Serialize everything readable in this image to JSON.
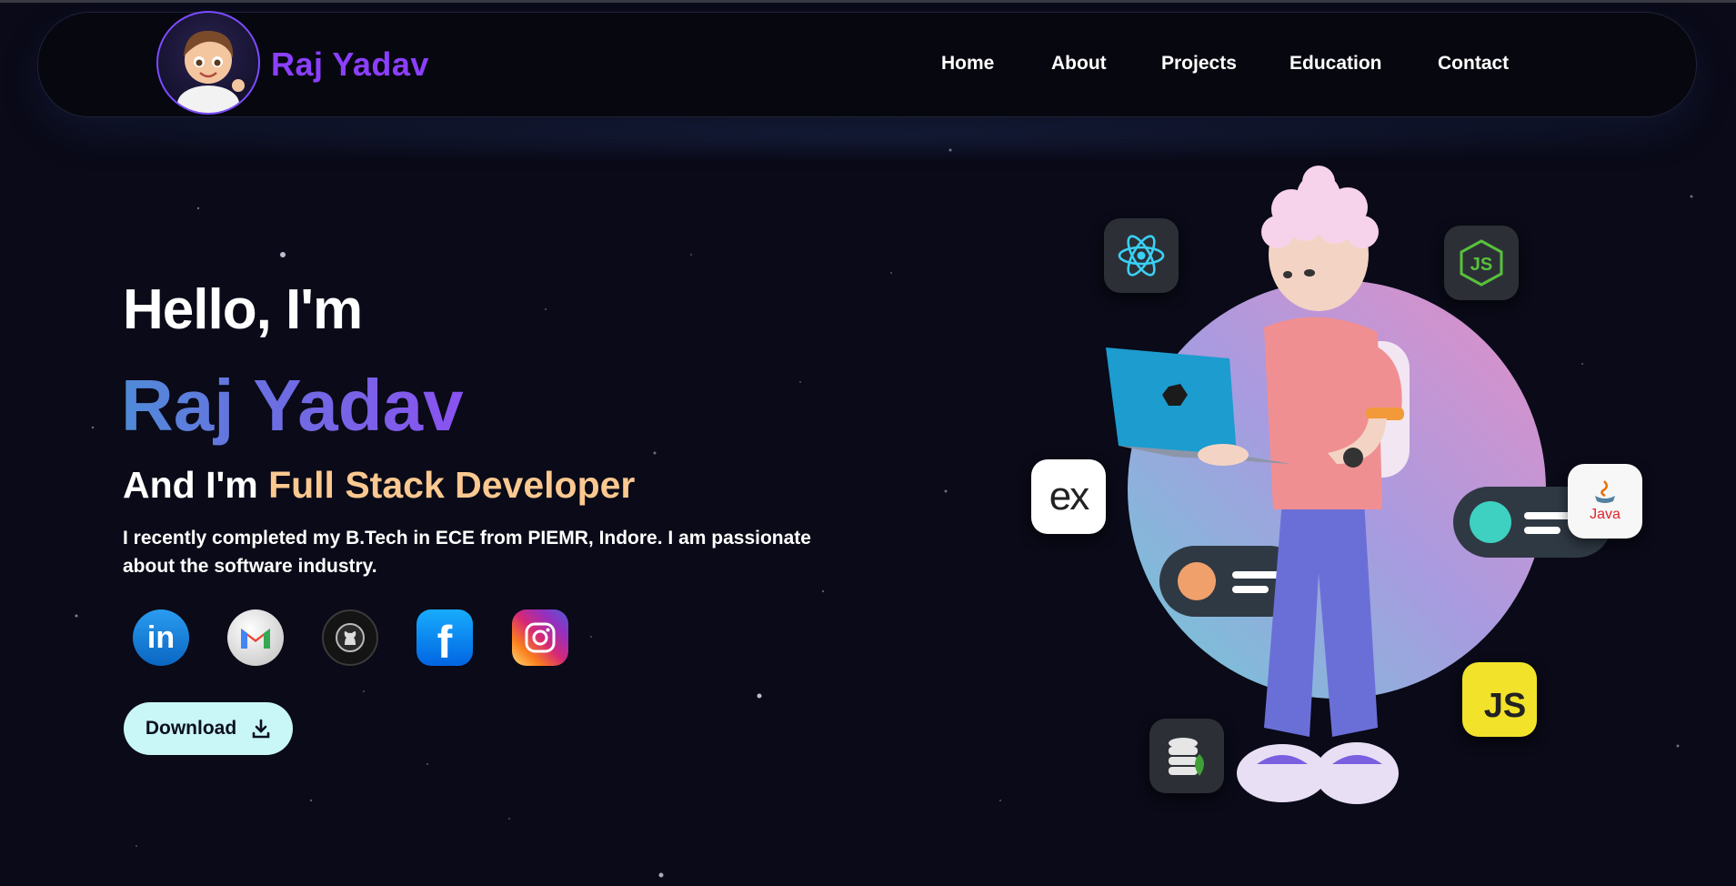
{
  "header": {
    "brand": "Raj Yadav",
    "nav": [
      "Home",
      "About",
      "Projects",
      "Education",
      "Contact"
    ]
  },
  "hero": {
    "greeting": "Hello, I'm",
    "name": "Raj Yadav",
    "role_prefix": "And I'm ",
    "role": "Full Stack Developer",
    "description_line1": "I recently completed my B.Tech in ECE from PIEMR, Indore. I am passionate",
    "description_line2": "about the software industry.",
    "download_label": "Download"
  },
  "social": [
    {
      "icon": "linkedin-icon",
      "glyph": "in",
      "color": "#1a7fd6"
    },
    {
      "icon": "gmail-icon",
      "glyph": "M",
      "color": "#d9d9d9"
    },
    {
      "icon": "github-icon",
      "glyph": "",
      "color": "#1b1b1b"
    },
    {
      "icon": "facebook-icon",
      "glyph": "f",
      "color": "#1778f2"
    },
    {
      "icon": "instagram-icon",
      "glyph": "",
      "color": "#d6249f"
    }
  ],
  "tech_tiles": {
    "express": "ex",
    "javascript": "JS",
    "java": "Java"
  },
  "colors": {
    "background": "#0a0a18",
    "brand": "#8b3fff",
    "role_highlight": "#fbc890",
    "download_bg": "#c9f6f6"
  }
}
